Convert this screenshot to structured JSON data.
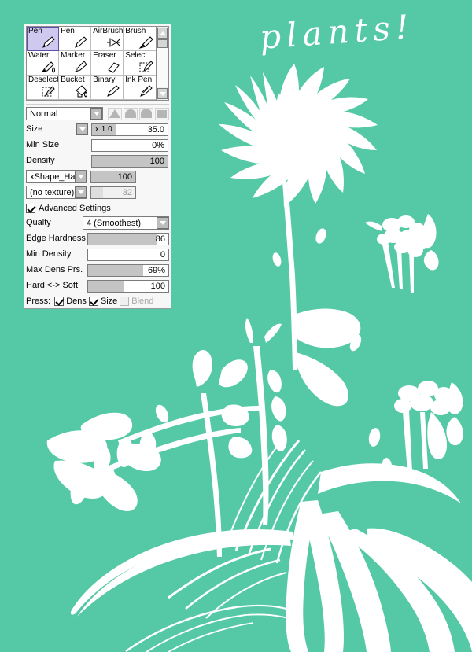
{
  "canvas": {
    "background_color": "#55c9a5",
    "ink_color": "#ffffff",
    "title_text": "plants!",
    "artwork_subject": "white plant silhouettes: chrysanthemum, bellflowers, grasses, leaves"
  },
  "panel": {
    "tools": [
      {
        "label": "Pen",
        "icon": "pen-icon",
        "selected": true
      },
      {
        "label": "Pen",
        "icon": "pen-icon",
        "selected": false
      },
      {
        "label": "AirBrush",
        "icon": "airbrush-icon",
        "selected": false
      },
      {
        "label": "Brush",
        "icon": "brush-icon",
        "selected": false
      },
      {
        "label": "Water",
        "icon": "water-icon",
        "selected": false
      },
      {
        "label": "Marker",
        "icon": "marker-icon",
        "selected": false
      },
      {
        "label": "Eraser",
        "icon": "eraser-icon",
        "selected": false
      },
      {
        "label": "Select",
        "icon": "select-icon",
        "selected": false
      },
      {
        "label": "Deselect",
        "icon": "deselect-icon",
        "selected": false
      },
      {
        "label": "Bucket",
        "icon": "bucket-icon",
        "selected": false
      },
      {
        "label": "Binary",
        "icon": "binary-icon",
        "selected": false
      },
      {
        "label": "Ink Pen",
        "icon": "inkpen-icon",
        "selected": false
      }
    ],
    "selection_highlight_color": "#cfc8ef",
    "blend_mode": {
      "value": "Normal",
      "shape_buttons": [
        "triangle-profile",
        "round-profile",
        "flat-round-profile",
        "square-profile"
      ]
    },
    "size": {
      "label": "Size",
      "multiplier_text": "x 1.0",
      "value_text": "35.0",
      "fill_percent": 32
    },
    "min_size": {
      "label": "Min Size",
      "value_text": "0%",
      "fill_percent": 0
    },
    "density": {
      "label": "Density",
      "value_text": "100",
      "fill_percent": 100
    },
    "shape": {
      "value": "xShape_HalfRound",
      "amount_text": "100",
      "amount_fill_percent": 100
    },
    "texture": {
      "value": "(no texture)",
      "amount_text": "32",
      "amount_fill_percent": 26,
      "disabled": true
    },
    "advanced": {
      "label": "Advanced Settings",
      "checked": true,
      "quality": {
        "label": "Qualty",
        "value": "4 (Smoothest)"
      },
      "edge_hardness": {
        "label": "Edge Hardness",
        "value_text": "86",
        "fill_percent": 86
      },
      "min_density": {
        "label": "Min Density",
        "value_text": "0",
        "fill_percent": 0
      },
      "max_dens_prs": {
        "label": "Max Dens Prs.",
        "value_text": "69%",
        "fill_percent": 69
      },
      "hard_soft": {
        "label": "Hard <-> Soft",
        "value_text": "100",
        "fill_percent": 45
      },
      "pressure": {
        "label": "Press:",
        "options": [
          {
            "label": "Dens",
            "checked": true,
            "disabled": false
          },
          {
            "label": "Size",
            "checked": true,
            "disabled": false
          },
          {
            "label": "Blend",
            "checked": false,
            "disabled": true
          }
        ]
      }
    }
  }
}
